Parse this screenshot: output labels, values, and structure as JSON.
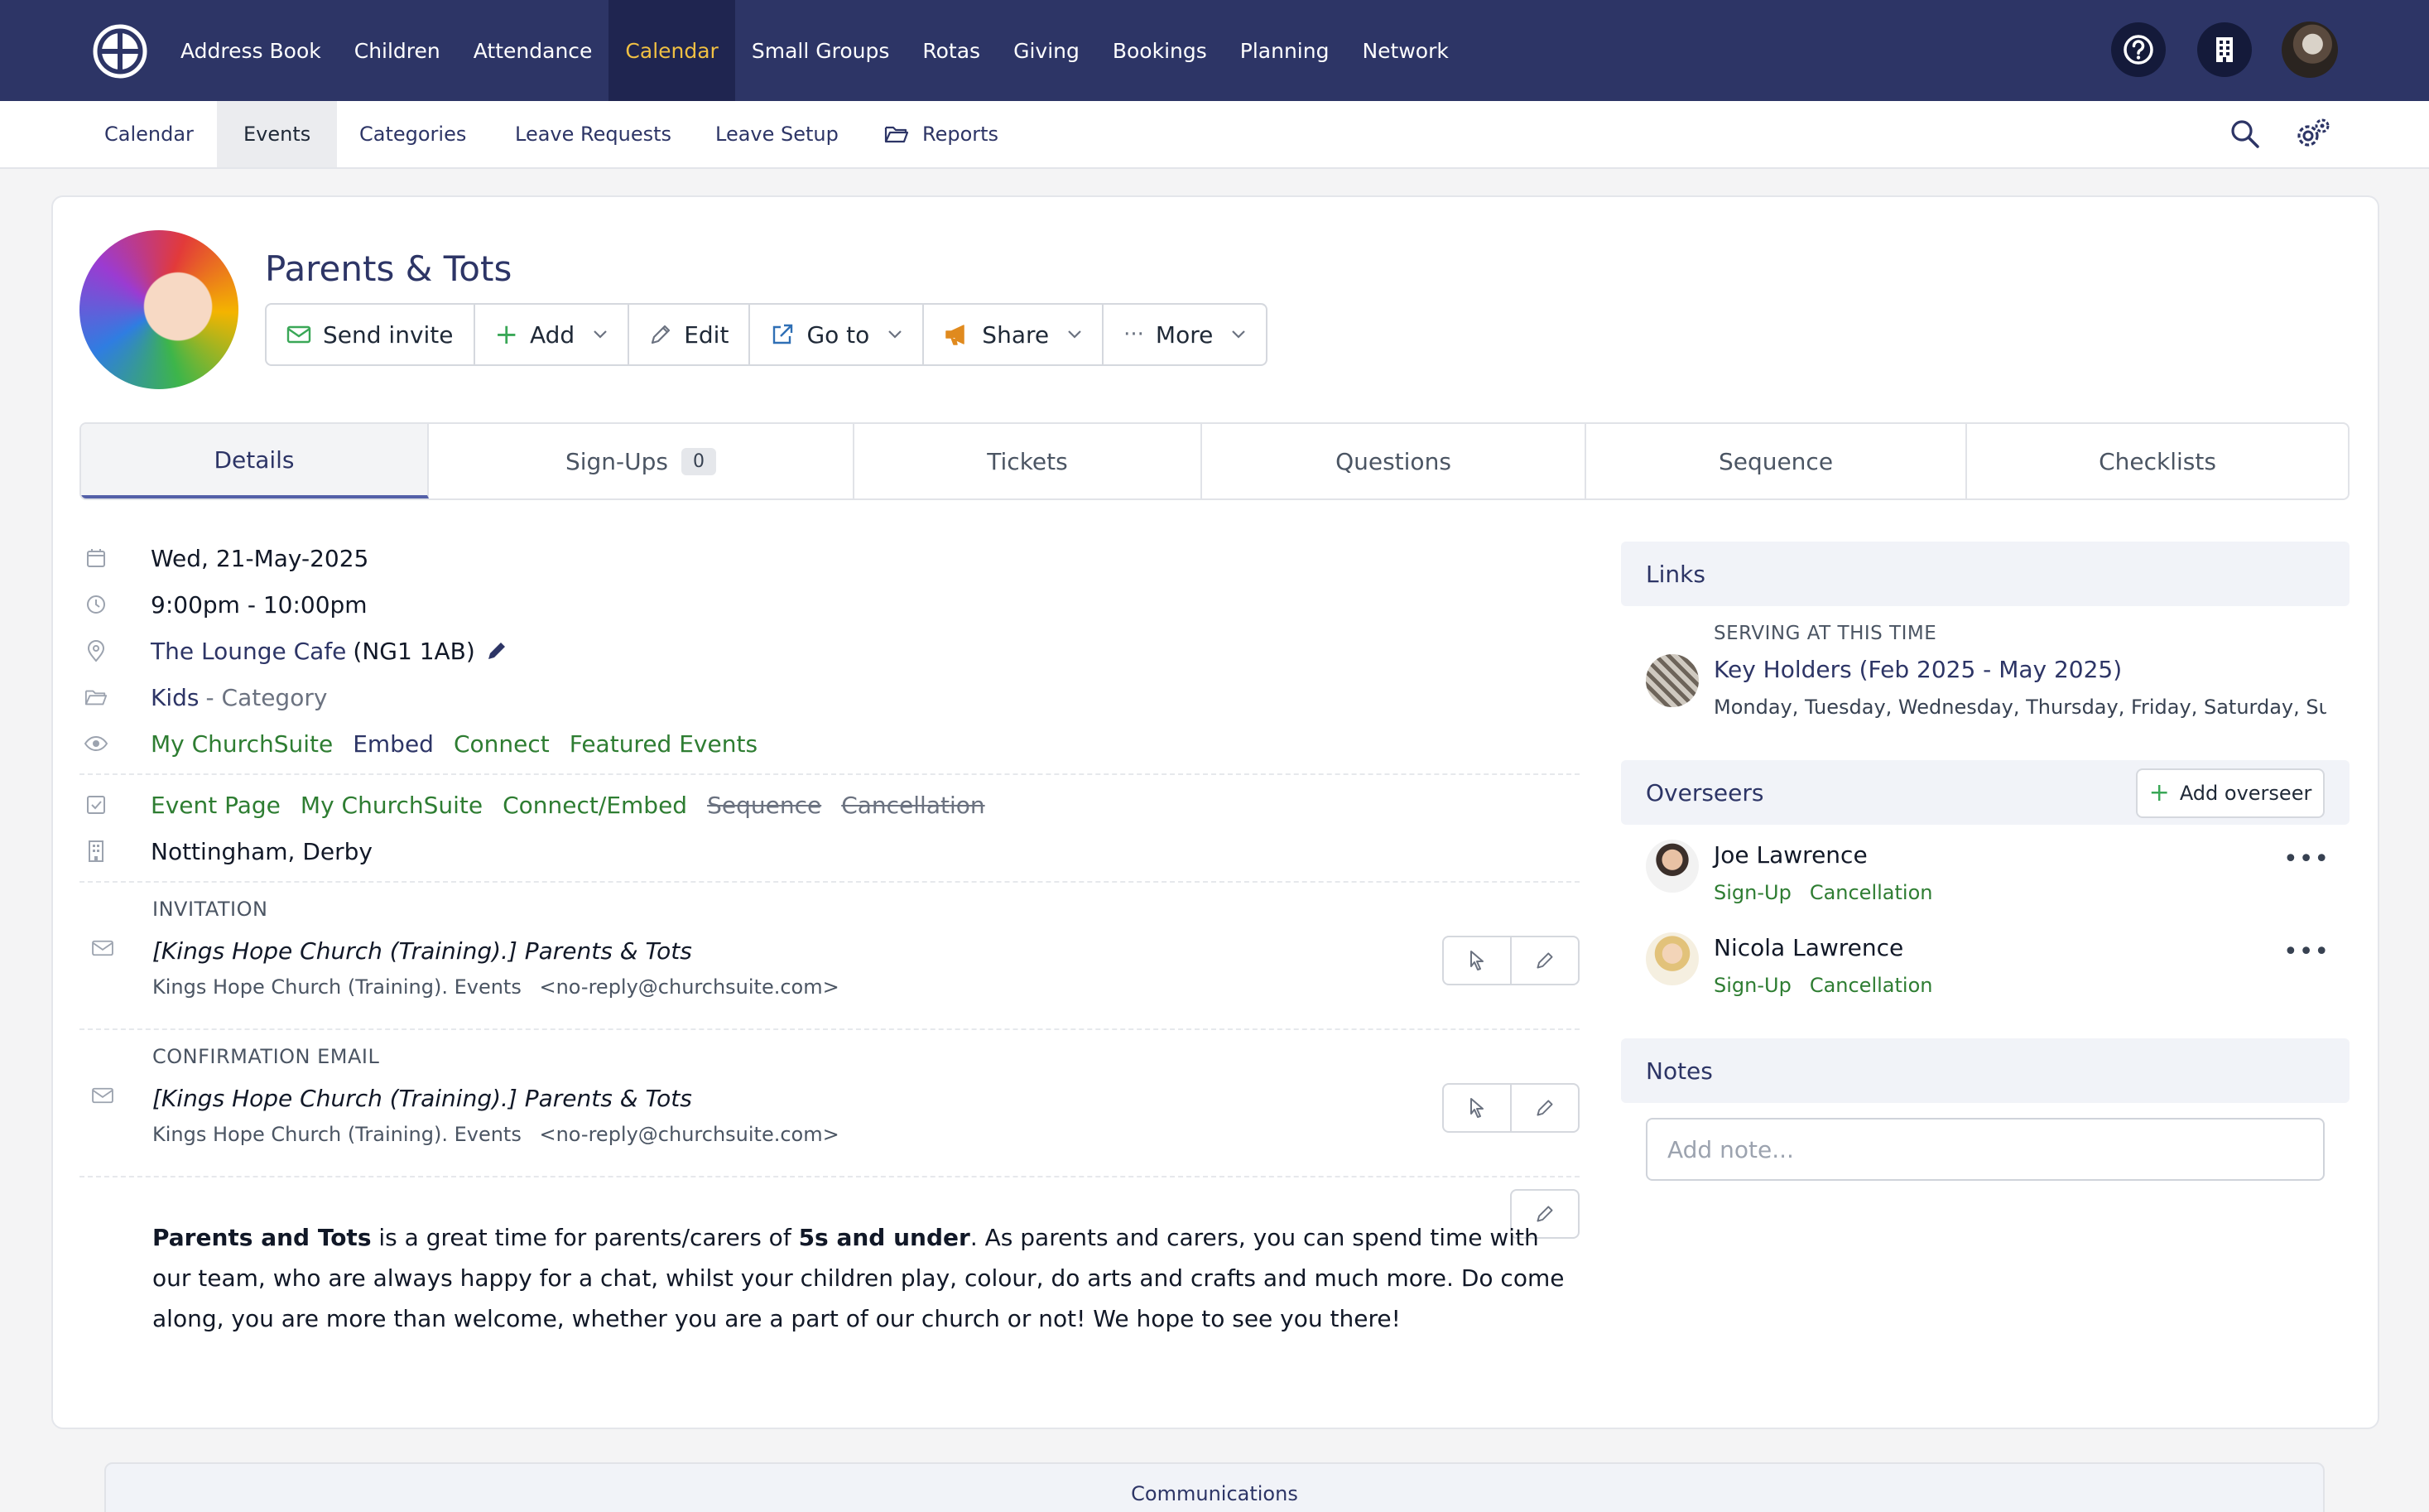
{
  "topnav": {
    "items": [
      {
        "label": "Address Book"
      },
      {
        "label": "Children"
      },
      {
        "label": "Attendance"
      },
      {
        "label": "Calendar",
        "active": true
      },
      {
        "label": "Small Groups"
      },
      {
        "label": "Rotas"
      },
      {
        "label": "Giving"
      },
      {
        "label": "Bookings"
      },
      {
        "label": "Planning"
      },
      {
        "label": "Network"
      }
    ],
    "icons": [
      "help-icon",
      "building-icon",
      "user-avatar"
    ],
    "bg_color": "#2d3566",
    "active_color": "#f0c043"
  },
  "subnav": {
    "items": [
      {
        "label": "Calendar"
      },
      {
        "label": "Events",
        "active": true
      },
      {
        "label": "Categories"
      },
      {
        "label": "Leave Requests"
      },
      {
        "label": "Leave Setup"
      },
      {
        "label": "Reports",
        "icon": "folder-open-icon"
      }
    ],
    "right_icons": [
      "search-icon",
      "settings-gears-icon"
    ]
  },
  "event": {
    "title": "Parents & Tots",
    "toolbar": {
      "send_invite": "Send invite",
      "add": "Add",
      "edit": "Edit",
      "go_to": "Go to",
      "share": "Share",
      "more": "More"
    }
  },
  "tabs": [
    {
      "label": "Details",
      "active": true
    },
    {
      "label": "Sign-Ups",
      "count": "0"
    },
    {
      "label": "Tickets"
    },
    {
      "label": "Questions"
    },
    {
      "label": "Sequence"
    },
    {
      "label": "Checklists"
    }
  ],
  "details": {
    "date": "Wed, 21-May-2025",
    "time": "9:00pm - 10:00pm",
    "location_name": "The Lounge Cafe",
    "location_postcode": "(NG1 1AB)",
    "category_name": "Kids",
    "category_suffix": "- Category",
    "visibility": [
      "My ChurchSuite",
      "Embed",
      "Connect",
      "Featured Events"
    ],
    "features_enabled": [
      "Event Page",
      "My ChurchSuite",
      "Connect/Embed"
    ],
    "features_disabled": [
      "Sequence",
      "Cancellation"
    ],
    "sites": "Nottingham, Derby",
    "invitation": {
      "label": "INVITATION",
      "subject": "[Kings Hope Church (Training).] Parents & Tots",
      "from_name": "Kings Hope Church (Training). Events",
      "from_email": "<no-reply@churchsuite.com>"
    },
    "confirmation": {
      "label": "CONFIRMATION EMAIL",
      "subject": "[Kings Hope Church (Training).] Parents & Tots",
      "from_name": "Kings Hope Church (Training). Events",
      "from_email": "<no-reply@churchsuite.com>"
    },
    "description": {
      "bold1": "Parents and Tots",
      "text1": " is a great time for parents/carers of ",
      "bold2": "5s and under",
      "text2": ". As parents and carers, you can spend time with our team, who are always happy for a chat, whilst your children play, colour, do arts and crafts and much more. Do come along, you are more than welcome, whether you are a part of our church or not! We hope to see you there!"
    }
  },
  "links": {
    "heading": "Links",
    "serving_label": "SERVING AT THIS TIME",
    "rota_name": "Key Holders (Feb 2025 - May 2025)",
    "rota_days": "Monday, Tuesday, Wednesday, Thursday, Friday, Saturday, Sunday"
  },
  "overseers": {
    "heading": "Overseers",
    "add_label": "Add overseer",
    "people": [
      {
        "name": "Joe Lawrence",
        "link1": "Sign-Up",
        "link2": "Cancellation"
      },
      {
        "name": "Nicola Lawrence",
        "link1": "Sign-Up",
        "link2": "Cancellation"
      }
    ]
  },
  "notes": {
    "heading": "Notes",
    "placeholder": "Add note..."
  },
  "communications": {
    "label": "Communications"
  },
  "colors": {
    "navy": "#2d3566",
    "green_link": "#2e7d32",
    "share_orange": "#e08a1e",
    "send_green": "#3aa757"
  }
}
